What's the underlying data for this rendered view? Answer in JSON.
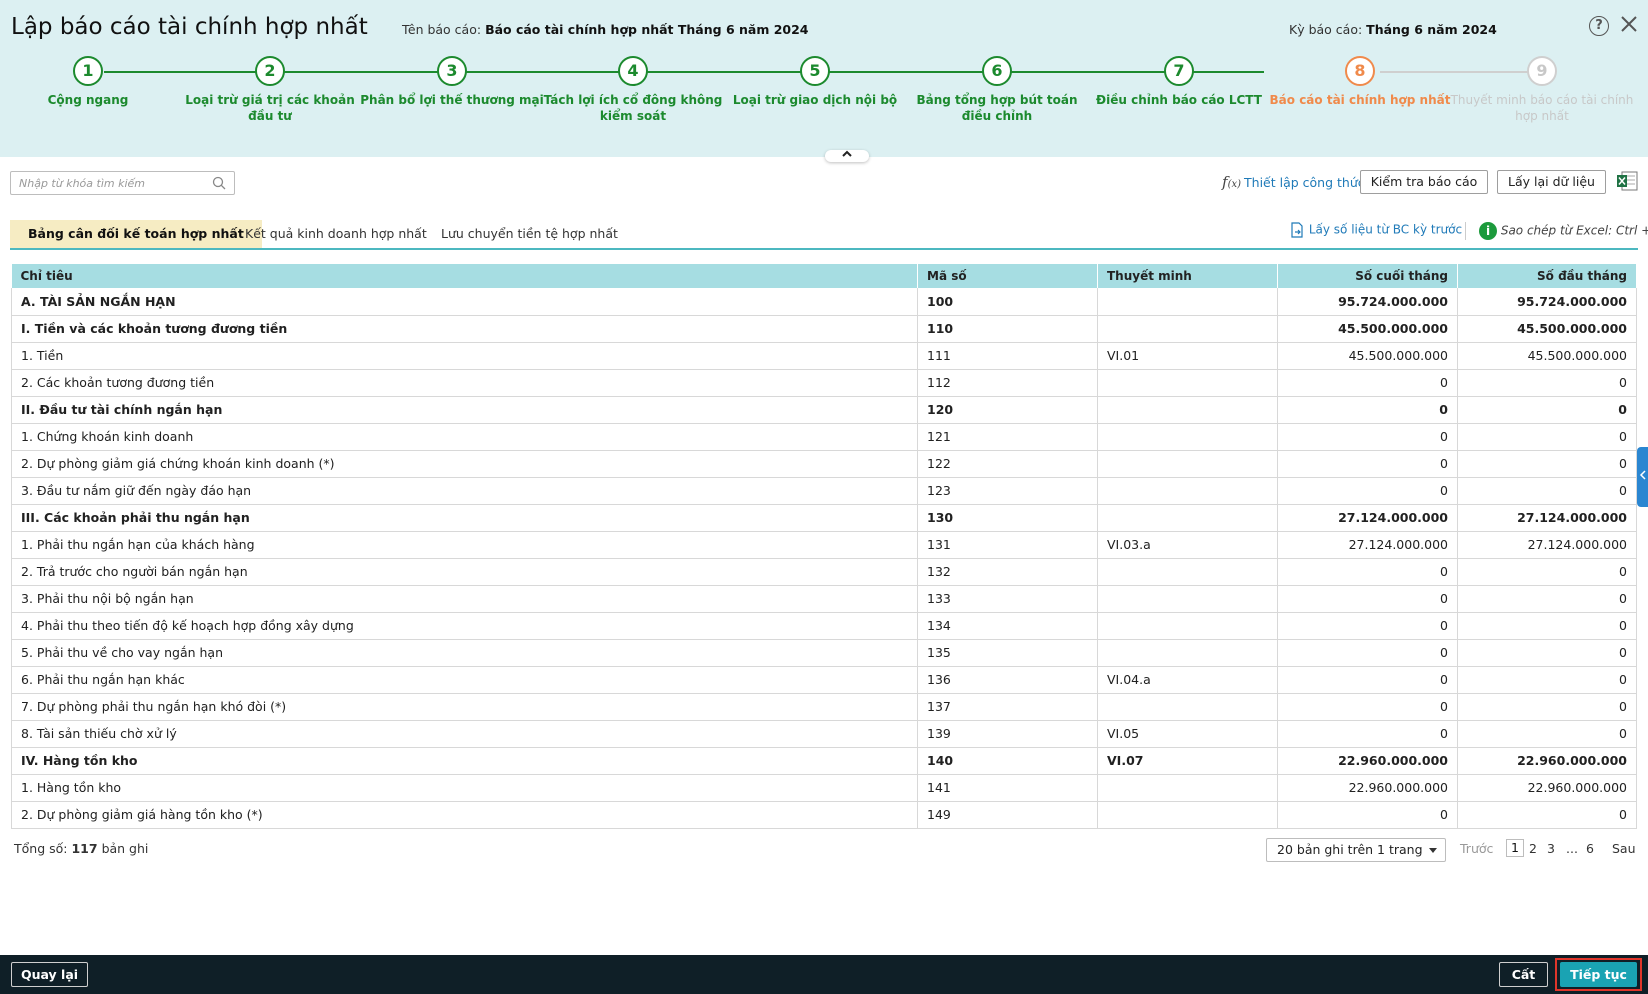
{
  "header": {
    "title": "Lập báo cáo tài chính hợp nhất",
    "report_name_label": "Tên báo cáo:",
    "report_name": "Báo cáo tài chính hợp nhất Tháng 6 năm 2024",
    "period_label": "Kỳ báo cáo:",
    "period": "Tháng 6 năm 2024",
    "help": "?"
  },
  "steps": [
    {
      "num": "1",
      "label": "Cộng ngang",
      "state": "done"
    },
    {
      "num": "2",
      "label": "Loại trừ giá trị các khoản đầu tư",
      "state": "done"
    },
    {
      "num": "3",
      "label": "Phân bổ lợi thế thương mại",
      "state": "done"
    },
    {
      "num": "4",
      "label": "Tách lợi ích cổ đông không kiểm soát",
      "state": "done"
    },
    {
      "num": "5",
      "label": "Loại trừ giao dịch nội bộ",
      "state": "done"
    },
    {
      "num": "6",
      "label": "Bảng tổng hợp bút toán điều chỉnh",
      "state": "done"
    },
    {
      "num": "7",
      "label": "Điều chỉnh báo cáo LCTT",
      "state": "done"
    },
    {
      "num": "8",
      "label": "Báo cáo tài chính hợp nhất",
      "state": "active"
    },
    {
      "num": "9",
      "label": "Thuyết minh báo cáo tài chính hợp nhất",
      "state": "pending"
    }
  ],
  "toolbar": {
    "search_placeholder": "Nhập từ khóa tìm kiếm",
    "formula_label": "Thiết lập công thức",
    "check_label": "Kiểm tra báo cáo",
    "reload_label": "Lấy lại dữ liệu"
  },
  "tabs": [
    {
      "label": "Bảng cân đối kế toán hợp nhất",
      "active": true
    },
    {
      "label": "Kết quả kinh doanh hợp nhất",
      "active": false
    },
    {
      "label": "Lưu chuyển tiền tệ hợp nhất",
      "active": false
    }
  ],
  "tab_actions": {
    "prev_report": "Lấy số liệu từ BC kỳ trước",
    "paste_hint": "Sao chép từ Excel: Ctrl + V"
  },
  "table": {
    "columns": [
      "Chỉ tiêu",
      "Mã số",
      "Thuyết minh",
      "Số cuối tháng",
      "Số đầu tháng"
    ],
    "rows": [
      {
        "name": "A. TÀI SẢN NGẮN HẠN",
        "code": "100",
        "note": "",
        "end": "95.724.000.000",
        "start": "95.724.000.000",
        "bold": true
      },
      {
        "name": "I. Tiền và các khoản tương đương tiền",
        "code": "110",
        "note": "",
        "end": "45.500.000.000",
        "start": "45.500.000.000",
        "bold": true
      },
      {
        "name": "1. Tiền",
        "code": "111",
        "note": "VI.01",
        "end": "45.500.000.000",
        "start": "45.500.000.000",
        "bold": false
      },
      {
        "name": "2. Các khoản tương đương tiền",
        "code": "112",
        "note": "",
        "end": "0",
        "start": "0",
        "bold": false
      },
      {
        "name": "II. Đầu tư tài chính ngắn hạn",
        "code": "120",
        "note": "",
        "end": "0",
        "start": "0",
        "bold": true
      },
      {
        "name": "1. Chứng khoán kinh doanh",
        "code": "121",
        "note": "",
        "end": "0",
        "start": "0",
        "bold": false
      },
      {
        "name": "2. Dự phòng giảm giá chứng khoán kinh doanh (*)",
        "code": "122",
        "note": "",
        "end": "0",
        "start": "0",
        "bold": false
      },
      {
        "name": "3. Đầu tư nắm giữ đến ngày đáo hạn",
        "code": "123",
        "note": "",
        "end": "0",
        "start": "0",
        "bold": false
      },
      {
        "name": "III. Các khoản phải thu ngắn hạn",
        "code": "130",
        "note": "",
        "end": "27.124.000.000",
        "start": "27.124.000.000",
        "bold": true
      },
      {
        "name": "1. Phải thu ngắn hạn của khách hàng",
        "code": "131",
        "note": "VI.03.a",
        "end": "27.124.000.000",
        "start": "27.124.000.000",
        "bold": false
      },
      {
        "name": "2. Trả trước cho người bán ngắn hạn",
        "code": "132",
        "note": "",
        "end": "0",
        "start": "0",
        "bold": false
      },
      {
        "name": "3. Phải thu nội bộ ngắn hạn",
        "code": "133",
        "note": "",
        "end": "0",
        "start": "0",
        "bold": false
      },
      {
        "name": "4. Phải thu theo tiến độ kế hoạch hợp đồng xây dựng",
        "code": "134",
        "note": "",
        "end": "0",
        "start": "0",
        "bold": false
      },
      {
        "name": "5. Phải thu về cho vay ngắn hạn",
        "code": "135",
        "note": "",
        "end": "0",
        "start": "0",
        "bold": false
      },
      {
        "name": "6. Phải thu ngắn hạn khác",
        "code": "136",
        "note": "VI.04.a",
        "end": "0",
        "start": "0",
        "bold": false
      },
      {
        "name": "7. Dự phòng phải thu ngắn hạn khó đòi (*)",
        "code": "137",
        "note": "",
        "end": "0",
        "start": "0",
        "bold": false
      },
      {
        "name": "8. Tài sản thiếu chờ xử lý",
        "code": "139",
        "note": "VI.05",
        "end": "0",
        "start": "0",
        "bold": false
      },
      {
        "name": "IV. Hàng tồn kho",
        "code": "140",
        "note": "VI.07",
        "end": "22.960.000.000",
        "start": "22.960.000.000",
        "bold": true
      },
      {
        "name": "1. Hàng tồn kho",
        "code": "141",
        "note": "",
        "end": "22.960.000.000",
        "start": "22.960.000.000",
        "bold": false
      },
      {
        "name": "2. Dự phòng giảm giá hàng tồn kho (*)",
        "code": "149",
        "note": "",
        "end": "0",
        "start": "0",
        "bold": false
      }
    ]
  },
  "footer": {
    "total_label": "Tổng số:",
    "total_count": "117",
    "total_suffix": "bản ghi",
    "page_size": "20 bản ghi trên 1 trang",
    "prev": "Trước",
    "pages": [
      "1",
      "2",
      "3",
      "...",
      "6"
    ],
    "next": "Sau"
  },
  "bottom": {
    "back": "Quay lại",
    "save": "Cất",
    "continue": "Tiếp tục"
  },
  "colors": {
    "header_bg": "#dcf0f2",
    "step_done": "#1c8a2e",
    "step_active": "#f08a4b",
    "table_header": "#a6dde2",
    "primary": "#1aa3b3"
  }
}
